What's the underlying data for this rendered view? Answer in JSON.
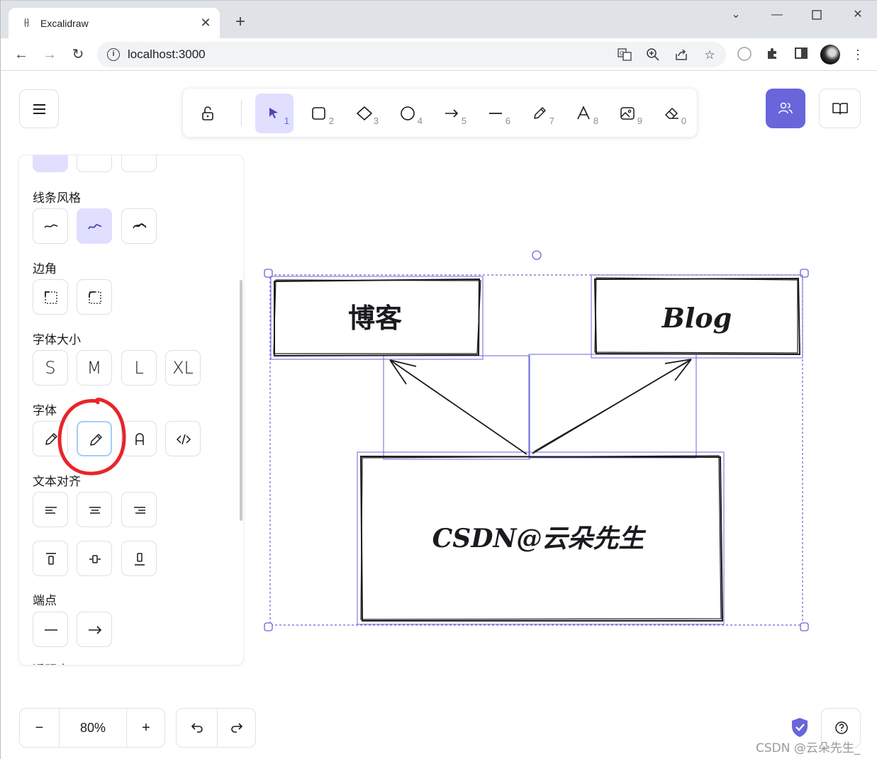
{
  "browser": {
    "tab_title": "Excalidraw",
    "url": "localhost:3000"
  },
  "toolbar": {
    "tools": [
      {
        "name": "selection",
        "key": "1"
      },
      {
        "name": "rectangle",
        "key": "2"
      },
      {
        "name": "diamond",
        "key": "3"
      },
      {
        "name": "ellipse",
        "key": "4"
      },
      {
        "name": "arrow",
        "key": "5"
      },
      {
        "name": "line",
        "key": "6"
      },
      {
        "name": "draw",
        "key": "7"
      },
      {
        "name": "text",
        "key": "8"
      },
      {
        "name": "image",
        "key": "9"
      },
      {
        "name": "eraser",
        "key": "0"
      }
    ],
    "active_tool": "selection"
  },
  "properties": {
    "sloppiness_label": "线条风格",
    "edges_label": "边角",
    "font_size_label": "字体大小",
    "font_sizes": [
      "S",
      "M",
      "L",
      "XL"
    ],
    "font_family_label": "字体",
    "text_align_label": "文本对齐",
    "arrowheads_label": "端点",
    "opacity_label_partial": "透明度"
  },
  "footer": {
    "zoom": "80%"
  },
  "canvas": {
    "box_top_left_text": "博客",
    "box_top_right_text": "Blog",
    "box_bottom_text": "CSDN@云朵先生"
  },
  "watermark": "CSDN @云朵先生_",
  "colors": {
    "accent": "#6965db",
    "selected_bg": "#e0dfff",
    "annotation_circle": "#e8252a"
  }
}
